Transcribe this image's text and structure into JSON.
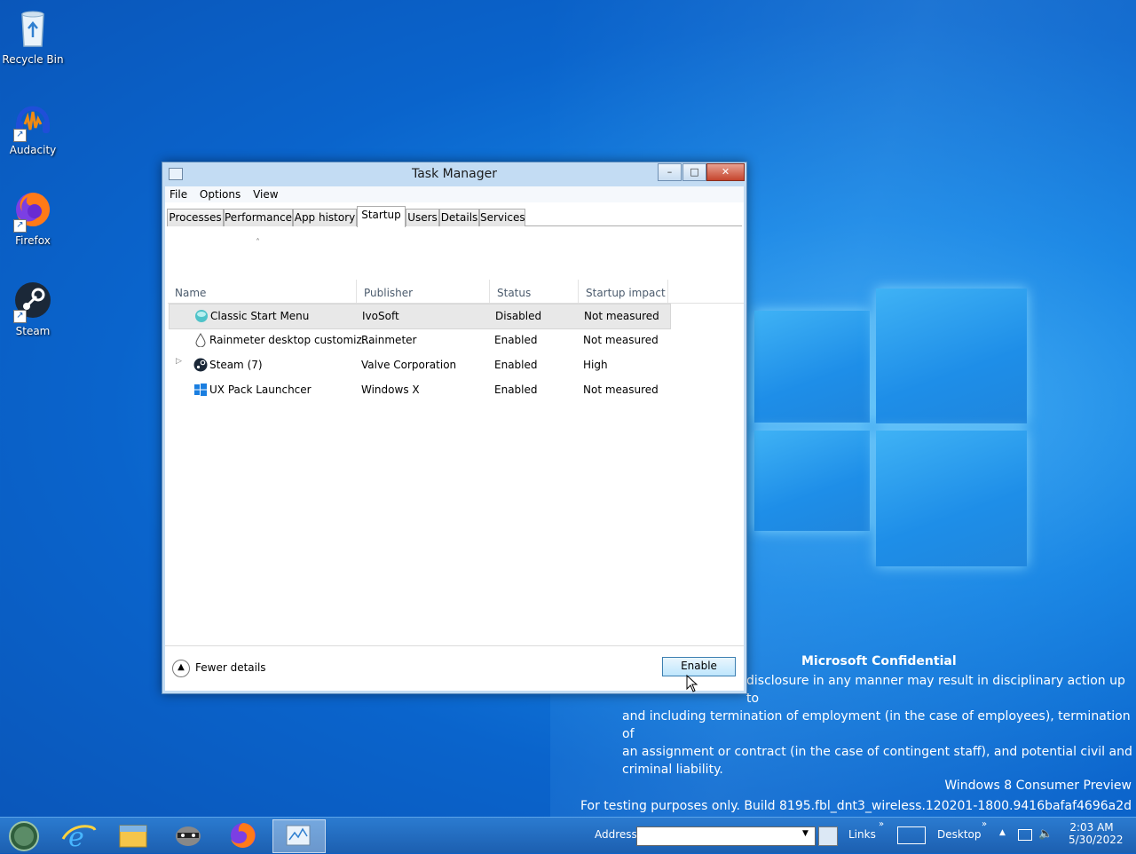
{
  "desktop": {
    "icons": [
      {
        "label": "Recycle Bin",
        "icon": "recycle-bin-icon"
      },
      {
        "label": "Audacity",
        "icon": "audacity-icon"
      },
      {
        "label": "Firefox",
        "icon": "firefox-icon"
      },
      {
        "label": "Steam",
        "icon": "steam-icon"
      }
    ],
    "watermark": {
      "heading": "Microsoft Confidential",
      "lines": [
        "disclosure in any manner may result in disciplinary action up to",
        "and including termination of employment (in the case of employees), termination of",
        "an assignment or contract (in the case of contingent staff), and potential civil and",
        "criminal liability."
      ],
      "edition": "Windows 8 Consumer Preview",
      "build": "For testing purposes only. Build 8195.fbl_dnt3_wireless.120201-1800.9416bafaf4696a2d"
    }
  },
  "window": {
    "title": "Task Manager",
    "caption_buttons": {
      "minimize": "–",
      "maximize": "□",
      "close": "✕"
    },
    "menu": [
      "File",
      "Options",
      "View"
    ],
    "tabs": [
      "Processes",
      "Performance",
      "App history",
      "Startup",
      "Users",
      "Details",
      "Services"
    ],
    "active_tab": "Startup",
    "columns": [
      "Name",
      "Publisher",
      "Status",
      "Startup impact"
    ],
    "sort_indicator": "˄",
    "rows": [
      {
        "name": "Classic Start Menu",
        "publisher": "IvoSoft",
        "status": "Disabled",
        "impact": "Not measured",
        "icon": "classic-start-menu-icon",
        "selected": true,
        "expandable": false
      },
      {
        "name": "Rainmeter desktop customiz...",
        "publisher": "Rainmeter",
        "status": "Enabled",
        "impact": "Not measured",
        "icon": "rainmeter-icon",
        "selected": false,
        "expandable": false
      },
      {
        "name": "Steam (7)",
        "publisher": "Valve Corporation",
        "status": "Enabled",
        "impact": "High",
        "icon": "steam-icon",
        "selected": false,
        "expandable": true
      },
      {
        "name": "UX Pack Launchcer",
        "publisher": "Windows X",
        "status": "Enabled",
        "impact": "Not measured",
        "icon": "windows-logo-icon",
        "selected": false,
        "expandable": false
      }
    ],
    "footer": {
      "fewer_details": "Fewer details",
      "enable_button": "Enable"
    }
  },
  "taskbar": {
    "apps": [
      "start-orb-icon",
      "internet-explorer-icon",
      "file-explorer-icon",
      "raccoon-app-icon",
      "firefox-icon",
      "task-manager-icon"
    ],
    "address_label": "Address",
    "address_value": "",
    "links_label": "Links",
    "desktop_label": "Desktop",
    "clock_time": "2:03 AM",
    "clock_date": "5/30/2022"
  },
  "colors": {
    "accent": "#1583e3",
    "selection": "#e8e8e8",
    "enable_button": "#bee6fd"
  }
}
